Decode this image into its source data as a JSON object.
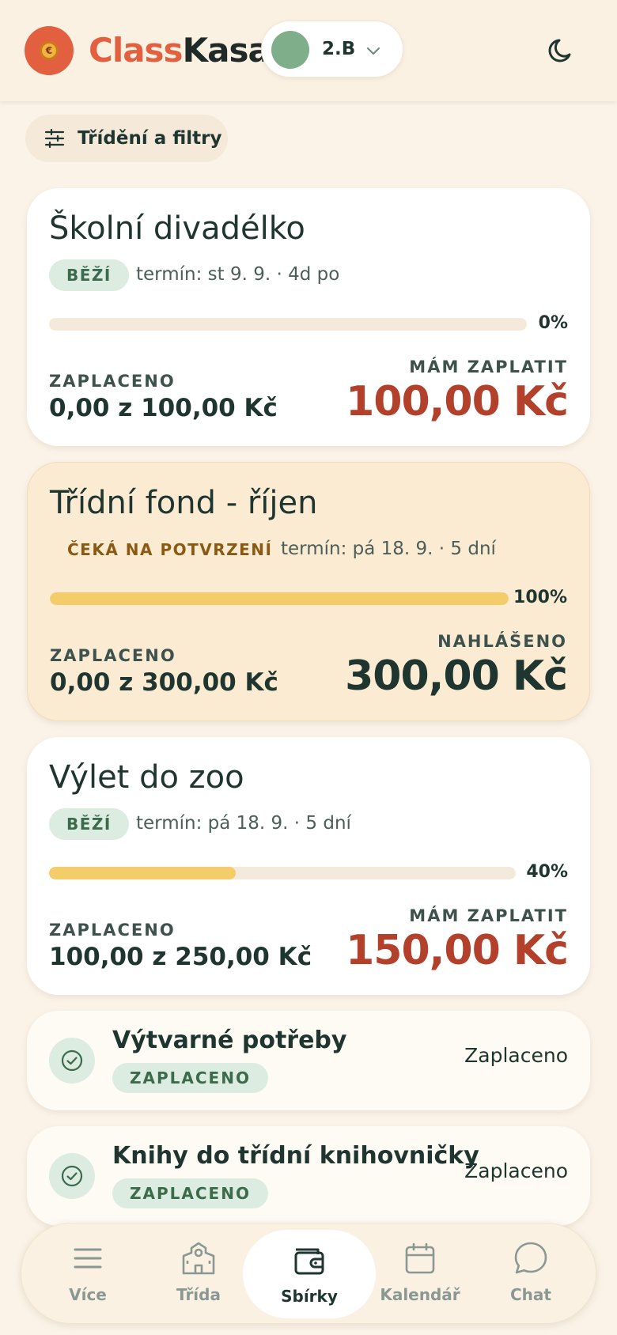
{
  "header": {
    "brand_part1": "Class",
    "brand_part2": "Kasa",
    "logo_symbol": "€",
    "class_name": "2.B",
    "colors": {
      "brand": "#e2603f",
      "class_dot": "#7fae8a"
    }
  },
  "filters": {
    "label": "Třídění a filtry"
  },
  "collections": [
    {
      "title": "Školní divadélko",
      "badge": "BĚŽÍ",
      "due": "termín: st 9. 9. · 4d po",
      "progress_percent": 0,
      "progress_label": "0%",
      "paid_label": "ZAPLACENO",
      "paid_value": "0,00 z 100,00 Kč",
      "amount_label": "MÁM ZAPLATIT",
      "amount": "100,00 Kč"
    },
    {
      "title": "Třídní fond - říjen",
      "badge": "ČEKÁ NA POTVRZENÍ",
      "due": "termín: pá 18. 9. · 5 dní",
      "progress_percent": 100,
      "progress_label": "100%",
      "paid_label": "ZAPLACENO",
      "paid_value": "0,00 z 300,00 Kč",
      "amount_label": "NAHLÁŠENO",
      "amount": "300,00 Kč"
    },
    {
      "title": "Výlet do zoo",
      "badge": "BĚŽÍ",
      "due": "termín: pá 18. 9. · 5 dní",
      "progress_percent": 40,
      "progress_label": "40%",
      "paid_label": "ZAPLACENO",
      "paid_value": "100,00 z 250,00 Kč",
      "amount_label": "MÁM ZAPLATIT",
      "amount": "150,00 Kč"
    }
  ],
  "paid_collections": [
    {
      "title": "Výtvarné potřeby",
      "badge": "ZAPLACENO",
      "status": "Zaplaceno"
    },
    {
      "title": "Knihy do třídní knihovničky",
      "badge": "ZAPLACENO",
      "status": "Zaplaceno"
    }
  ],
  "nav": {
    "items": [
      {
        "label": "Více",
        "icon": "menu-icon"
      },
      {
        "label": "Třída",
        "icon": "school-icon"
      },
      {
        "label": "Sbírky",
        "icon": "wallet-icon",
        "active": true
      },
      {
        "label": "Kalendář",
        "icon": "calendar-icon"
      },
      {
        "label": "Chat",
        "icon": "chat-icon"
      }
    ]
  }
}
